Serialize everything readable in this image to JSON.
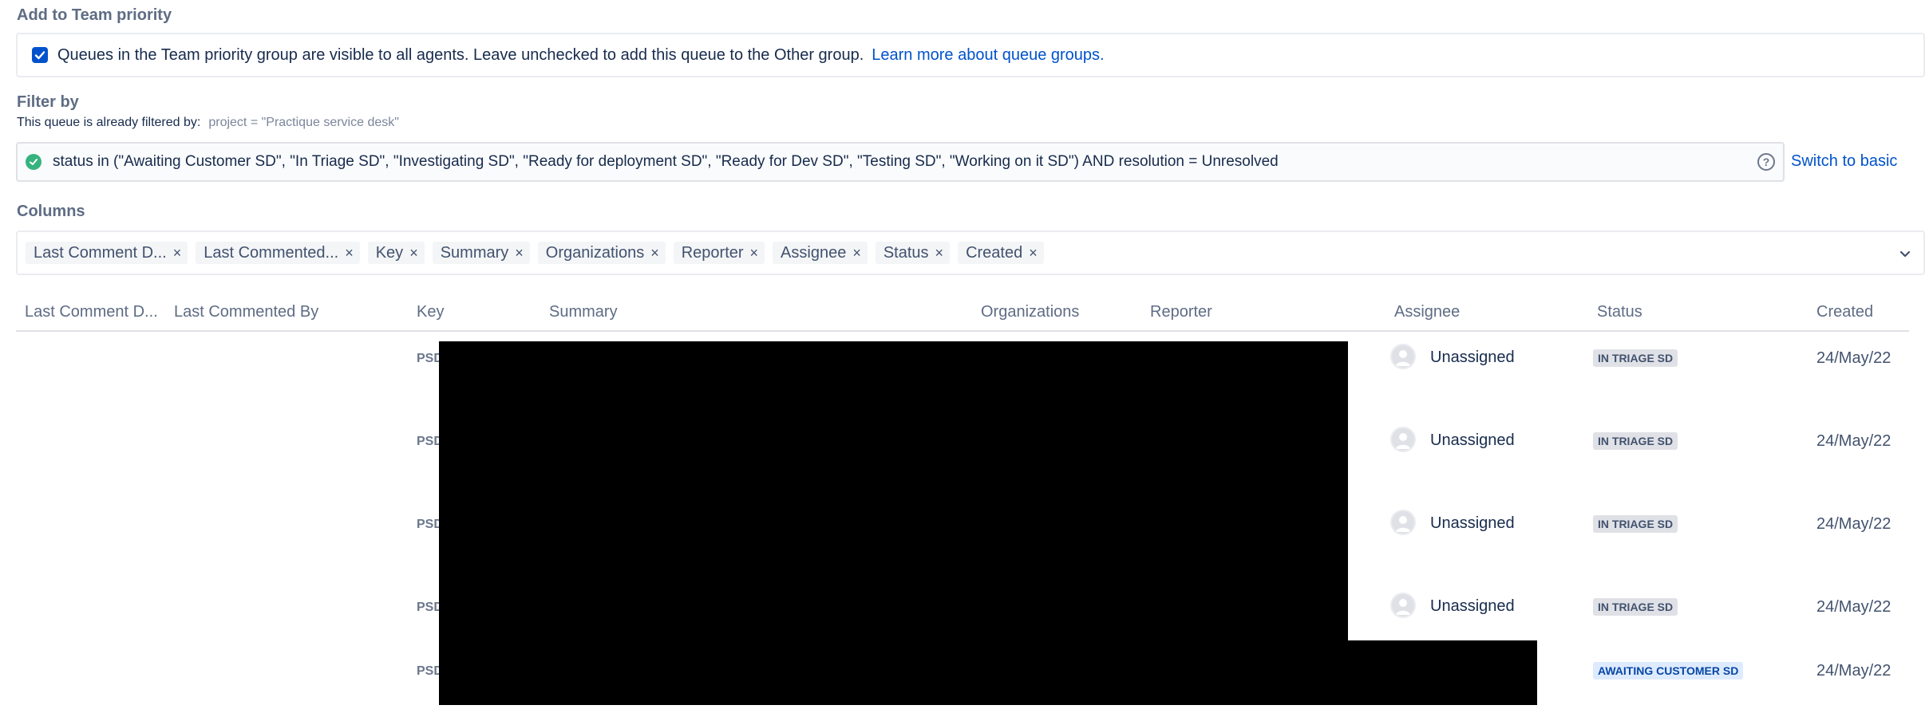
{
  "priority_section": {
    "title": "Add to Team priority",
    "checkbox_checked": true,
    "description": "Queues in the Team priority group are visible to all agents. Leave unchecked to add this queue to the Other group.",
    "learn_more": "Learn more about queue groups."
  },
  "filter_section": {
    "title": "Filter by",
    "prefiltered_label": "This queue is already filtered by:",
    "prefiltered_jql": "project = \"Practique service desk\"",
    "jql": "status in (\"Awaiting Customer SD\", \"In Triage SD\", \"Investigating SD\", \"Ready for deployment SD\", \"Ready for Dev SD\", \"Testing SD\", \"Working on it SD\") AND resolution = Unresolved",
    "help_icon": "?",
    "switch_label": "Switch to basic"
  },
  "columns_section": {
    "title": "Columns",
    "tags": [
      {
        "label": "Last Comment D..."
      },
      {
        "label": "Last Commented..."
      },
      {
        "label": "Key"
      },
      {
        "label": "Summary"
      },
      {
        "label": "Organizations"
      },
      {
        "label": "Reporter"
      },
      {
        "label": "Assignee"
      },
      {
        "label": "Status"
      },
      {
        "label": "Created"
      }
    ],
    "remove_glyph": "×"
  },
  "table": {
    "headers": {
      "last_comment_date": "Last Comment D...",
      "last_commented_by": "Last Commented By",
      "key": "Key",
      "summary": "Summary",
      "organizations": "Organizations",
      "reporter": "Reporter",
      "assignee": "Assignee",
      "status": "Status",
      "created": "Created"
    },
    "rows": [
      {
        "key": "PSD",
        "assignee": "Unassigned",
        "status": "IN TRIAGE SD",
        "created": "24/May/22"
      },
      {
        "key": "PSD",
        "assignee": "Unassigned",
        "status": "IN TRIAGE SD",
        "created": "24/May/22"
      },
      {
        "key": "PSD",
        "assignee": "Unassigned",
        "status": "IN TRIAGE SD",
        "created": "24/May/22"
      },
      {
        "key": "PSD",
        "assignee": "Unassigned",
        "status": "IN TRIAGE SD",
        "created": "24/May/22"
      },
      {
        "key": "PSD",
        "assignee": "",
        "status": "AWAITING CUSTOMER SD",
        "created": "24/May/22"
      }
    ]
  },
  "colors": {
    "link": "#0052cc",
    "checkbox": "#0052cc",
    "valid": "#36b37e",
    "triage_lozenge_bg": "#dfe1e6",
    "awaiting_lozenge_bg": "#deebff",
    "redaction": "#000000"
  }
}
